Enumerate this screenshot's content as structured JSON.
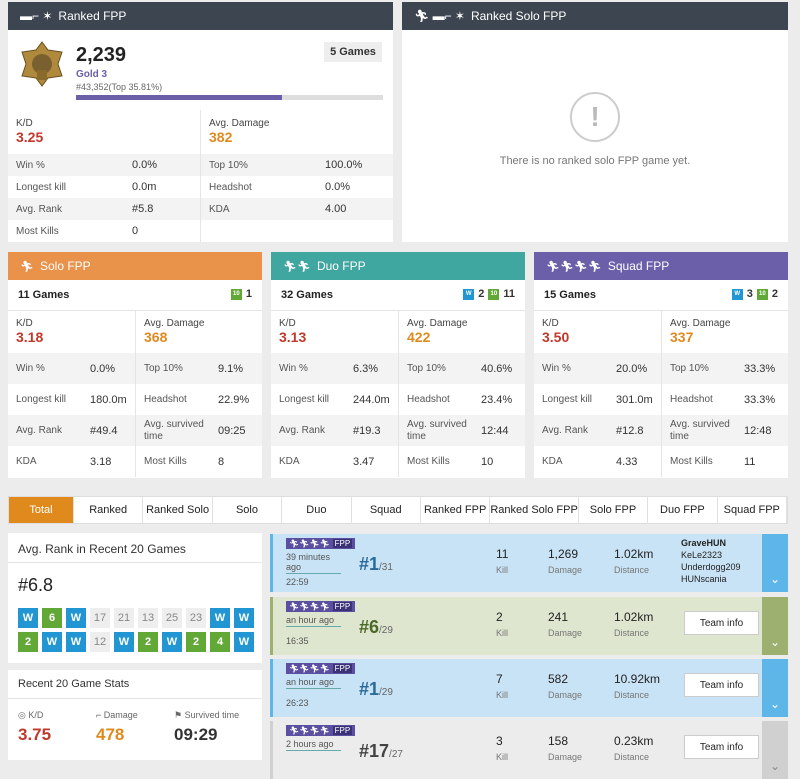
{
  "ranked_fpp": {
    "title": "Ranked FPP",
    "rating": "2,239",
    "games": "5 Games",
    "tier": "Gold 3",
    "position": "#43,352(Top 35.81%)",
    "progress_fraction": 0.67,
    "kd_label": "K/D",
    "kd_value": "3.25",
    "dmg_label": "Avg. Damage",
    "dmg_value": "382",
    "rows_left": [
      {
        "label": "Win %",
        "value": "0.0%"
      },
      {
        "label": "Longest kill",
        "value": "0.0m"
      },
      {
        "label": "Avg. Rank",
        "value": "#5.8"
      },
      {
        "label": "Most Kills",
        "value": "0"
      }
    ],
    "rows_right": [
      {
        "label": "Top 10%",
        "value": "100.0%"
      },
      {
        "label": "Headshot",
        "value": "0.0%"
      },
      {
        "label": "KDA",
        "value": "4.00"
      }
    ]
  },
  "ranked_solo_fpp": {
    "title": "Ranked Solo FPP",
    "empty_text": "There is no ranked solo FPP game yet."
  },
  "modes": [
    {
      "title": "Solo FPP",
      "color": "#e8924a",
      "games": "11 Games",
      "badges": [
        {
          "type": "g",
          "icon": "10",
          "count": "1"
        }
      ],
      "kd": "3.18",
      "dmg": "368",
      "left": [
        {
          "label": "Win %",
          "value": "0.0%"
        },
        {
          "label": "Longest kill",
          "value": "180.0m"
        },
        {
          "label": "Avg. Rank",
          "value": "#49.4"
        },
        {
          "label": "KDA",
          "value": "3.18"
        }
      ],
      "right": [
        {
          "label": "Top 10%",
          "value": "9.1%"
        },
        {
          "label": "Headshot",
          "value": "22.9%"
        },
        {
          "label": "Avg. survived time",
          "value": "09:25"
        },
        {
          "label": "Most Kills",
          "value": "8"
        }
      ]
    },
    {
      "title": "Duo FPP",
      "color": "#3fa6a0",
      "games": "32 Games",
      "badges": [
        {
          "type": "b",
          "icon": "W",
          "count": "2"
        },
        {
          "type": "g",
          "icon": "10",
          "count": "11"
        }
      ],
      "kd": "3.13",
      "dmg": "422",
      "left": [
        {
          "label": "Win %",
          "value": "6.3%"
        },
        {
          "label": "Longest kill",
          "value": "244.0m"
        },
        {
          "label": "Avg. Rank",
          "value": "#19.3"
        },
        {
          "label": "KDA",
          "value": "3.47"
        }
      ],
      "right": [
        {
          "label": "Top 10%",
          "value": "40.6%"
        },
        {
          "label": "Headshot",
          "value": "23.4%"
        },
        {
          "label": "Avg. survived time",
          "value": "12:44"
        },
        {
          "label": "Most Kills",
          "value": "10"
        }
      ]
    },
    {
      "title": "Squad FPP",
      "color": "#6a5fa8",
      "games": "15 Games",
      "badges": [
        {
          "type": "b",
          "icon": "W",
          "count": "3"
        },
        {
          "type": "g",
          "icon": "10",
          "count": "2"
        }
      ],
      "kd": "3.50",
      "dmg": "337",
      "left": [
        {
          "label": "Win %",
          "value": "20.0%"
        },
        {
          "label": "Longest kill",
          "value": "301.0m"
        },
        {
          "label": "Avg. Rank",
          "value": "#12.8"
        },
        {
          "label": "KDA",
          "value": "4.33"
        }
      ],
      "right": [
        {
          "label": "Top 10%",
          "value": "33.3%"
        },
        {
          "label": "Headshot",
          "value": "33.3%"
        },
        {
          "label": "Avg. survived time",
          "value": "12:48"
        },
        {
          "label": "Most Kills",
          "value": "11"
        }
      ]
    }
  ],
  "tabs": [
    "Total",
    "Ranked",
    "Ranked Solo",
    "Solo",
    "Duo",
    "Squad",
    "Ranked FPP",
    "Ranked Solo FPP",
    "Solo FPP",
    "Duo FPP",
    "Squad FPP"
  ],
  "avg_rank_panel": {
    "title": "Avg. Rank in Recent 20 Games",
    "value": "#6.8",
    "row1": [
      {
        "t": "W",
        "c": "b"
      },
      {
        "t": "6",
        "c": "g"
      },
      {
        "t": "W",
        "c": "b"
      },
      {
        "t": "17",
        "c": "n"
      },
      {
        "t": "21",
        "c": "n"
      },
      {
        "t": "13",
        "c": "n"
      },
      {
        "t": "25",
        "c": "n"
      },
      {
        "t": "23",
        "c": "n"
      },
      {
        "t": "W",
        "c": "b"
      },
      {
        "t": "W",
        "c": "b"
      }
    ],
    "row2": [
      {
        "t": "2",
        "c": "g"
      },
      {
        "t": "W",
        "c": "b"
      },
      {
        "t": "W",
        "c": "b"
      },
      {
        "t": "12",
        "c": "n"
      },
      {
        "t": "W",
        "c": "b"
      },
      {
        "t": "2",
        "c": "g"
      },
      {
        "t": "W",
        "c": "b"
      },
      {
        "t": "2",
        "c": "g"
      },
      {
        "t": "4",
        "c": "g"
      },
      {
        "t": "W",
        "c": "b"
      }
    ]
  },
  "recent_stats": {
    "title": "Recent 20 Game Stats",
    "kd_label": "K/D",
    "kd": "3.75",
    "dmg_label": "Damage",
    "dmg": "478",
    "surv_label": "Survived time",
    "surv": "09:29"
  },
  "games": [
    {
      "mode": "FPP",
      "time": "39 minutes ago",
      "duration": "22:59",
      "rank": "#1",
      "total": "/31",
      "kills": "11",
      "kill_label": "Kill",
      "damage": "1,269",
      "damage_label": "Damage",
      "distance": "1.02km",
      "distance_label": "Distance",
      "team": [
        "GraveHUN",
        "KeLe2323",
        "Underdogg209",
        "HUNscania"
      ],
      "bg": "#c8e3f5",
      "chev": "#5eb5e8",
      "rank_color": "#2a6a9a"
    },
    {
      "mode": "FPP",
      "time": "an hour ago",
      "duration": "16:35",
      "rank": "#6",
      "total": "/29",
      "kills": "2",
      "kill_label": "Kill",
      "damage": "241",
      "damage_label": "Damage",
      "distance": "1.02km",
      "distance_label": "Distance",
      "team_button": "Team info",
      "bg": "#dfe6cf",
      "chev": "#9db06f",
      "rank_color": "#4a6a2a"
    },
    {
      "mode": "FPP",
      "time": "an hour ago",
      "duration": "26:23",
      "rank": "#1",
      "total": "/29",
      "kills": "7",
      "kill_label": "Kill",
      "damage": "582",
      "damage_label": "Damage",
      "distance": "10.92km",
      "distance_label": "Distance",
      "team_button": "Team info",
      "bg": "#c8e3f5",
      "chev": "#5eb5e8",
      "rank_color": "#2a6a9a"
    },
    {
      "mode": "FPP",
      "time": "2 hours ago",
      "duration": "",
      "rank": "#17",
      "total": "/27",
      "kills": "3",
      "kill_label": "Kill",
      "damage": "158",
      "damage_label": "Damage",
      "distance": "0.23km",
      "distance_label": "Distance",
      "team_button": "Team info",
      "bg": "#ececec",
      "chev": "#d0d0d0",
      "rank_color": "#444"
    }
  ]
}
